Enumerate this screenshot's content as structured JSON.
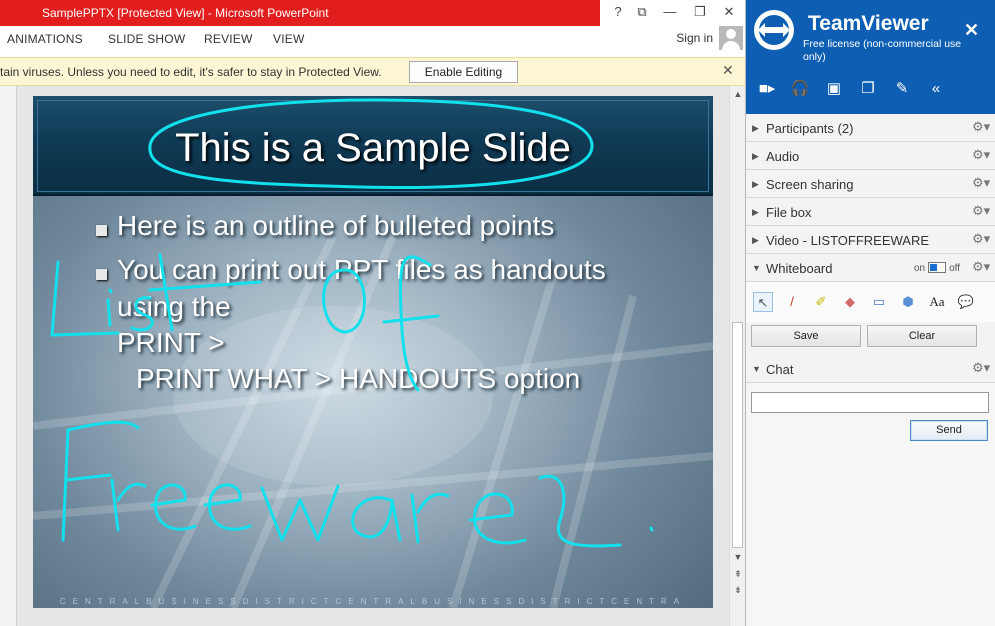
{
  "ppt": {
    "window_title": "SamplePPTX [Protected View] -  Microsoft PowerPoint",
    "window_buttons": {
      "help": "?",
      "restore_ribbon": "⧉",
      "minimize": "—",
      "maximize": "❐",
      "close": "✕"
    },
    "ribbon_tabs": [
      "ANIMATIONS",
      "SLIDE SHOW",
      "REVIEW",
      "VIEW"
    ],
    "sign_in": "Sign in",
    "protected_bar": {
      "message": "tain viruses. Unless you need to edit, it's safer to stay in Protected View.",
      "button": "Enable Editing",
      "close": "✕"
    },
    "slide": {
      "title": "This is a Sample Slide",
      "bullet1": "Here is an outline of bulleted points",
      "bullet2_line1": "You can print out PPT files as handouts",
      "bullet2_line2": "using the",
      "bullet2_line3": "PRINT >",
      "bullet2_line4": "PRINT WHAT > HANDOUTS option",
      "footer": "CENTRALBUSINESSDISTRICTCENTRALBUSINESSDISTRICTCENTRA"
    },
    "annotations": {
      "handwriting": [
        "List of",
        "Freeware"
      ],
      "ink_color": "#12e0ec"
    }
  },
  "teamviewer": {
    "title": "TeamViewer",
    "subtitle": "Free license (non-commercial use only)",
    "close": "✕",
    "brand_color": "#0e5fb3",
    "toolbar_icons": [
      "video-icon",
      "headset-icon",
      "chat-icon",
      "files-icon",
      "brush-icon",
      "collapse-icon"
    ],
    "sections": {
      "participants": "Participants (2)",
      "audio": "Audio",
      "screen_sharing": "Screen sharing",
      "file_box": "File box",
      "video": "Video  -  LISTOFFREEWARE",
      "whiteboard": "Whiteboard",
      "chat": "Chat"
    },
    "whiteboard": {
      "toggle_on": "on",
      "toggle_off": "off",
      "tools": [
        "pointer-icon",
        "pen-icon",
        "highlighter-icon",
        "eraser-icon",
        "rectangle-icon",
        "ellipse-icon",
        "text-icon",
        "speech-bubble-icon"
      ],
      "text_tool_label": "Aa",
      "save": "Save",
      "clear": "Clear"
    },
    "chat": {
      "input_value": "",
      "send": "Send"
    }
  }
}
